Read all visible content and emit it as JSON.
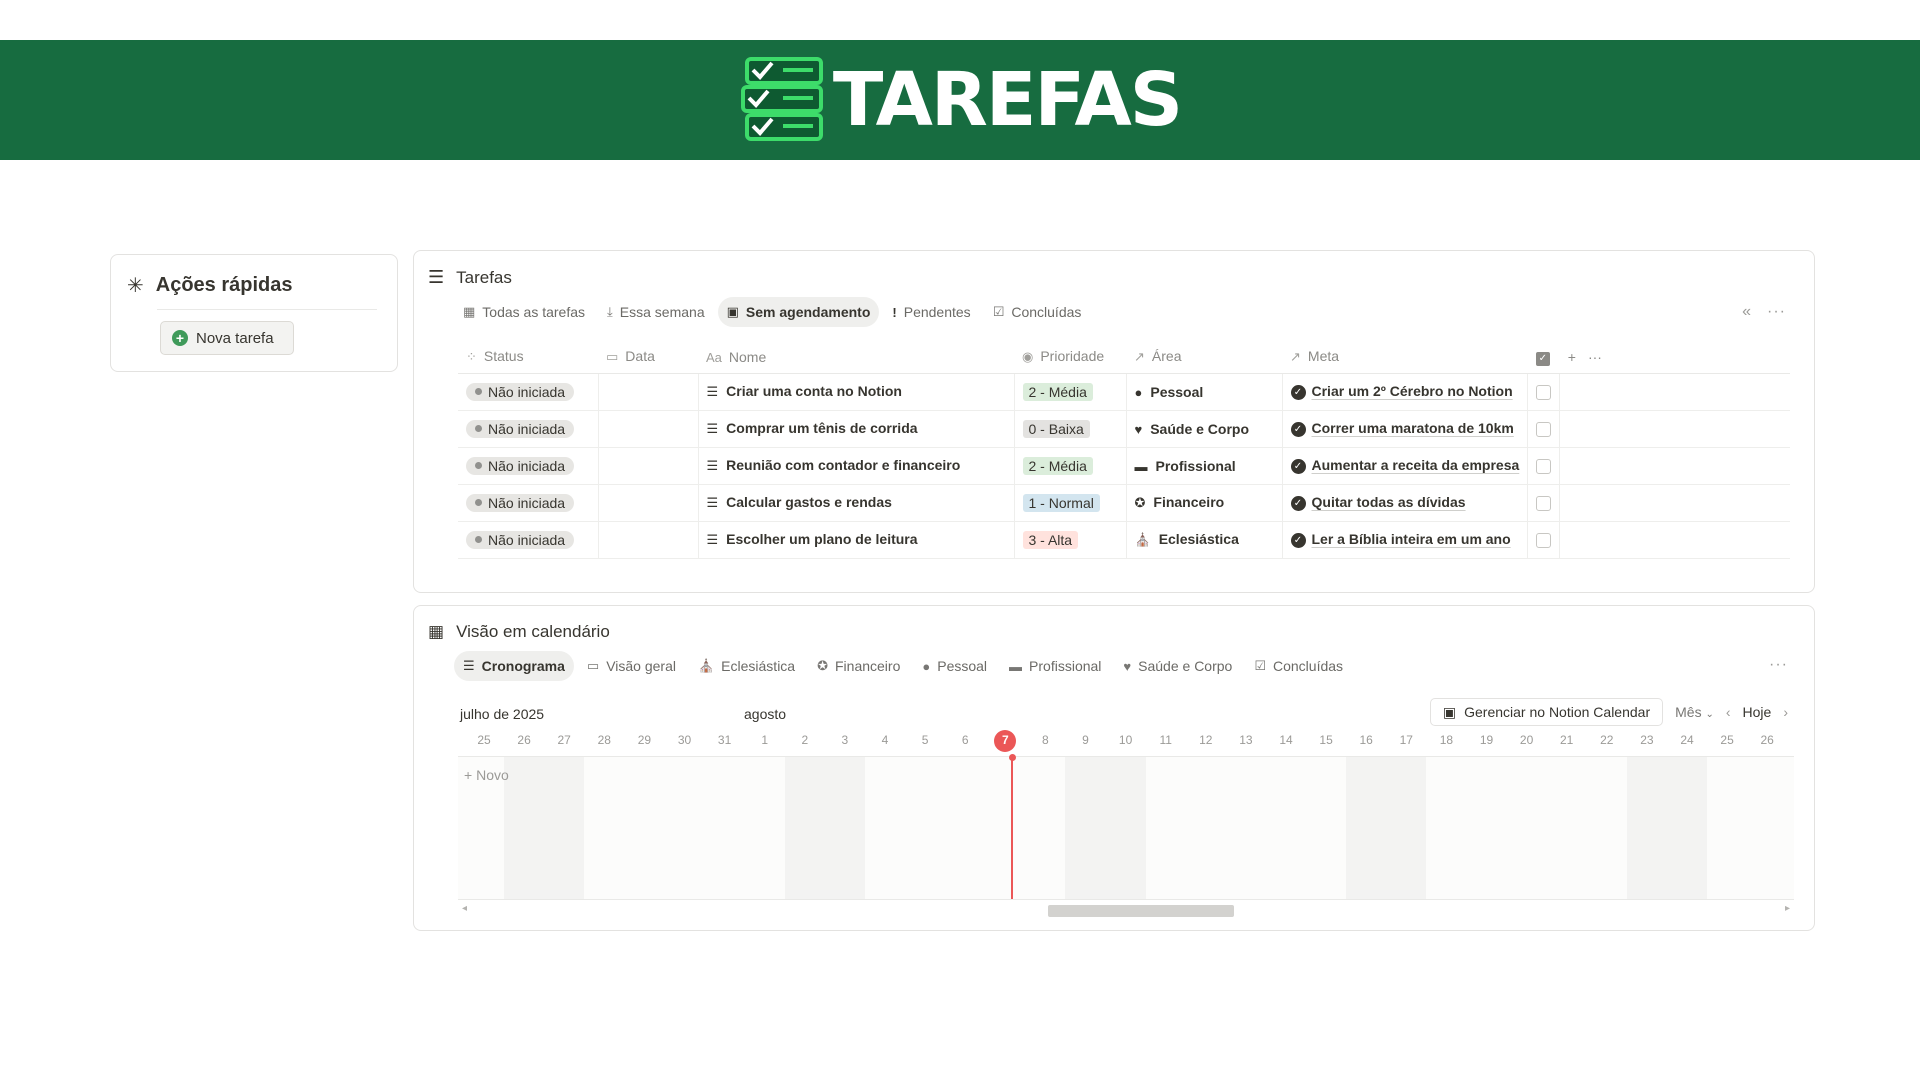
{
  "banner": {
    "title": "TAREFAS",
    "bg": "#176c40"
  },
  "quick_actions": {
    "title": "Ações rápidas",
    "new_task": "Nova tarefa"
  },
  "tasks": {
    "title": "Tarefas",
    "tabs": [
      {
        "label": "Todas as tarefas",
        "icon": "table-icon"
      },
      {
        "label": "Essa semana",
        "icon": "download-icon"
      },
      {
        "label": "Sem agendamento",
        "icon": "calendar-icon",
        "active": true
      },
      {
        "label": "Pendentes",
        "icon": "exclamation-icon"
      },
      {
        "label": "Concluídas",
        "icon": "checkbox-icon"
      }
    ],
    "columns": {
      "status": "Status",
      "data": "Data",
      "nome": "Nome",
      "prioridade": "Prioridade",
      "area": "Área",
      "meta": "Meta"
    },
    "rows": [
      {
        "status": "Não iniciada",
        "data": "",
        "nome": "Criar uma conta no Notion",
        "prioridade": "2 - Média",
        "area": "Pessoal",
        "meta": "Criar um 2º Cérebro no Notion"
      },
      {
        "status": "Não iniciada",
        "data": "",
        "nome": "Comprar um tênis de corrida",
        "prioridade": "0 - Baixa",
        "area": "Saúde e Corpo",
        "meta": "Correr uma maratona de 10km"
      },
      {
        "status": "Não iniciada",
        "data": "",
        "nome": "Reunião com contador e financeiro",
        "prioridade": "2 - Média",
        "area": "Profissional",
        "meta": "Aumentar a receita da empresa"
      },
      {
        "status": "Não iniciada",
        "data": "",
        "nome": "Calcular gastos e rendas",
        "prioridade": "1 - Normal",
        "area": "Financeiro",
        "meta": "Quitar todas as dívidas"
      },
      {
        "status": "Não iniciada",
        "data": "",
        "nome": "Escolher um plano de leitura",
        "prioridade": "3 - Alta",
        "area": "Eclesiástica",
        "meta": "Ler a Bíblia inteira em um ano"
      }
    ],
    "priority_colors": {
      "2 - Média": "#dbeddb",
      "0 - Baixa": "#e3e2e0",
      "1 - Normal": "#d3e5ef",
      "3 - Alta": "#ffe2dd"
    }
  },
  "calendar": {
    "title": "Visão em calendário",
    "tabs": [
      {
        "label": "Cronograma",
        "icon": "timeline-icon",
        "active": true
      },
      {
        "label": "Visão geral",
        "icon": "calendar-icon"
      },
      {
        "label": "Eclesiástica",
        "icon": "church-icon"
      },
      {
        "label": "Financeiro",
        "icon": "star-icon"
      },
      {
        "label": "Pessoal",
        "icon": "person-icon"
      },
      {
        "label": "Profissional",
        "icon": "briefcase-icon"
      },
      {
        "label": "Saúde e Corpo",
        "icon": "heart-icon"
      },
      {
        "label": "Concluídas",
        "icon": "checkbox-icon"
      }
    ],
    "month_1": "julho de 2025",
    "month_2": "agosto",
    "manage_button": "Gerenciar no Notion Calendar",
    "view_select": "Mês",
    "today_button": "Hoje",
    "days": [
      "25",
      "26",
      "27",
      "28",
      "29",
      "30",
      "31",
      "1",
      "2",
      "3",
      "4",
      "5",
      "6",
      "7",
      "8",
      "9",
      "10",
      "11",
      "12",
      "13",
      "14",
      "15",
      "16",
      "17",
      "18",
      "19",
      "20",
      "21",
      "22",
      "23",
      "24",
      "25",
      "26"
    ],
    "today": "7",
    "new_label": "Novo"
  }
}
